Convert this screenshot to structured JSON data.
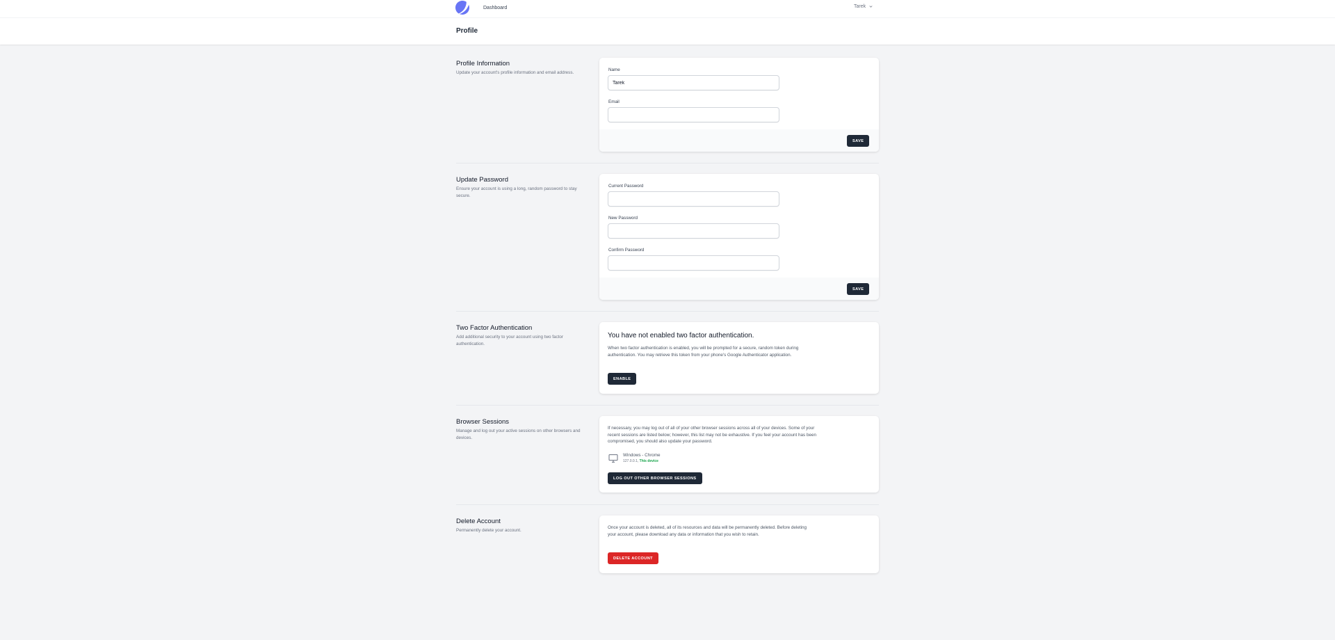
{
  "nav": {
    "logo_icon": "app-logo",
    "dashboard_link": "Dashboard",
    "user_name": "Tarek",
    "user_menu_icon": "chevron-down-icon"
  },
  "header": {
    "title": "Profile"
  },
  "profile_info": {
    "title": "Profile Information",
    "description": "Update your account's profile information and email address.",
    "name_label": "Name",
    "name_value": "Tarek",
    "email_label": "Email",
    "email_value": "",
    "save_label": "SAVE"
  },
  "update_password": {
    "title": "Update Password",
    "description": "Ensure your account is using a long, random password to stay secure.",
    "current_label": "Current Password",
    "new_label": "New Password",
    "confirm_label": "Confirm Password",
    "save_label": "SAVE"
  },
  "two_factor": {
    "title": "Two Factor Authentication",
    "description": "Add additional security to your account using two factor authentication.",
    "heading": "You have not enabled two factor authentication.",
    "text": "When two factor authentication is enabled, you will be prompted for a secure, random token during authentication. You may retrieve this token from your phone's Google Authenticator application.",
    "enable_label": "ENABLE"
  },
  "browser_sessions": {
    "title": "Browser Sessions",
    "description": "Manage and log out your active sessions on other browsers and devices.",
    "text": "If necessary, you may log out of all of your other browser sessions across all of your devices. Some of your recent sessions are listed below; however, this list may not be exhaustive. If you feel your account has been compromised, you should also update your password.",
    "session": {
      "icon": "desktop-icon",
      "platform": "Windows - Chrome",
      "ip": "127.0.0.1,",
      "current": "This device"
    },
    "logout_label": "LOG OUT OTHER BROWSER SESSIONS"
  },
  "delete_account": {
    "title": "Delete Account",
    "description": "Permanently delete your account.",
    "text": "Once your account is deleted, all of its resources and data will be permanently deleted. Before deleting your account, please download any data or information that you wish to retain.",
    "delete_label": "DELETE ACCOUNT"
  },
  "colors": {
    "background": "#f3f4f6",
    "dark_button": "#1f2937",
    "danger_button": "#dc2626",
    "logo_primary": "#6875f5",
    "this_device": "#16a34a"
  }
}
